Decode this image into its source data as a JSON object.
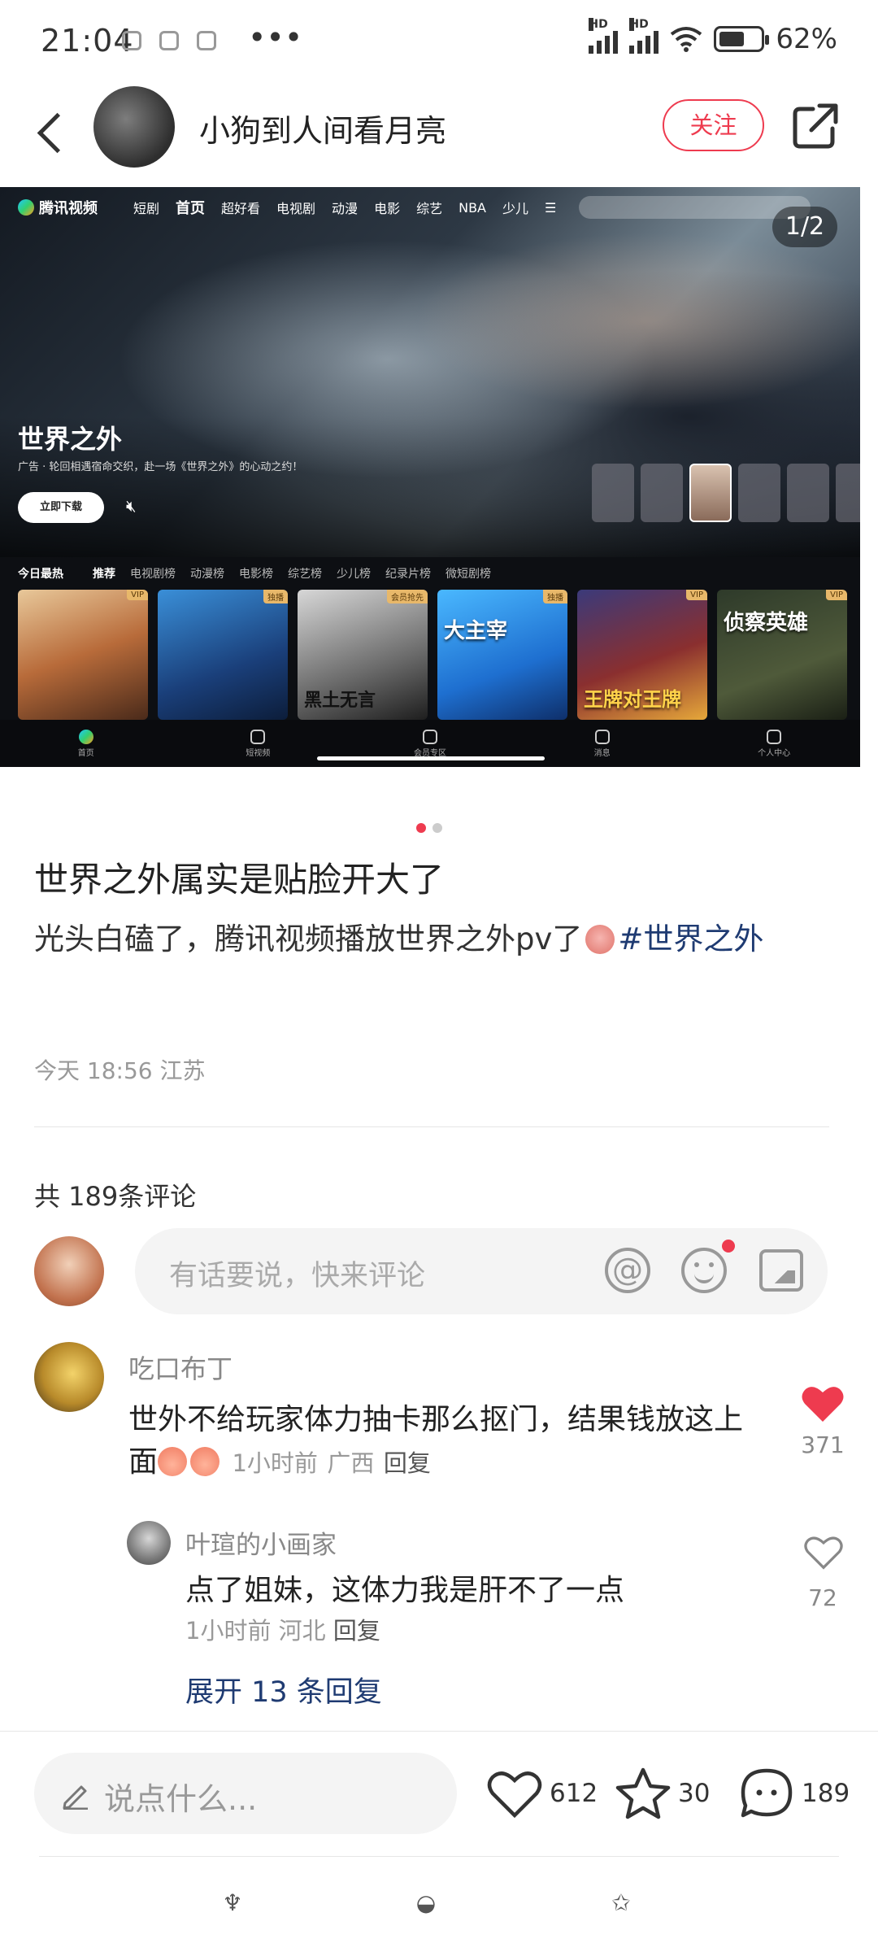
{
  "status_bar": {
    "time": "21:04",
    "more": "•••",
    "hd1": "HD",
    "hd2": "HD",
    "battery": "62%"
  },
  "header": {
    "author_name": "小狗到人间看月亮",
    "follow_label": "关注"
  },
  "banner": {
    "image_counter": "1/2",
    "tv_logo": "腾讯视频",
    "tv_nav": [
      "短剧",
      "首页",
      "超好看",
      "电视剧",
      "动漫",
      "电影",
      "综艺",
      "NBA",
      "少儿"
    ],
    "show_title": "世界之外",
    "show_subtitle": "广告 · 轮回相遇宿命交织，赴一场《世界之外》的心动之约！",
    "download_label": "立即下载",
    "rank_hot": "今日最热",
    "rank_tabs": [
      "推荐",
      "电视剧榜",
      "动漫榜",
      "电影榜",
      "综艺榜",
      "少儿榜",
      "纪录片榜",
      "微短剧榜"
    ],
    "posters": [
      {
        "title": "",
        "badge": "VIP"
      },
      {
        "title": "",
        "badge": "独播"
      },
      {
        "title": "黑土无言",
        "badge": "会员抢先"
      },
      {
        "title": "大主宰",
        "badge": "独播"
      },
      {
        "title": "王牌对王牌",
        "badge": "VIP"
      },
      {
        "title": "侦察英雄",
        "badge": "VIP"
      }
    ],
    "tabbar": [
      "首页",
      "短视频",
      "会员专区",
      "消息",
      "个人中心"
    ]
  },
  "post": {
    "title": "世界之外属实是贴脸开大了",
    "body": "光头白磕了，腾讯视频播放世界之外pv了",
    "hashtag": "#世界之外",
    "meta": "今天 18:56 江苏"
  },
  "comments_section": {
    "count_label": "共 189条评论",
    "input_placeholder": "有话要说，快来评论"
  },
  "comments": [
    {
      "user": "吃口布丁",
      "text": "世外不给玩家体力抽卡那么抠门，结果钱放这上面",
      "time": "1小时前",
      "location": "广西",
      "reply": "回复",
      "likes": "371",
      "liked": true
    },
    {
      "user": "叶瑄的小画家",
      "text": "点了姐妹，这体力我是肝不了一点",
      "time": "1小时前",
      "location": "河北",
      "reply": "回复",
      "likes": "72",
      "liked": false
    }
  ],
  "expand_replies": "展开 13 条回复",
  "bottom_bar": {
    "input_placeholder": "说点什么...",
    "likes": "612",
    "stars": "30",
    "comments": "189"
  },
  "colors": {
    "accent": "#ee3b4f",
    "link": "#1f3b72"
  }
}
